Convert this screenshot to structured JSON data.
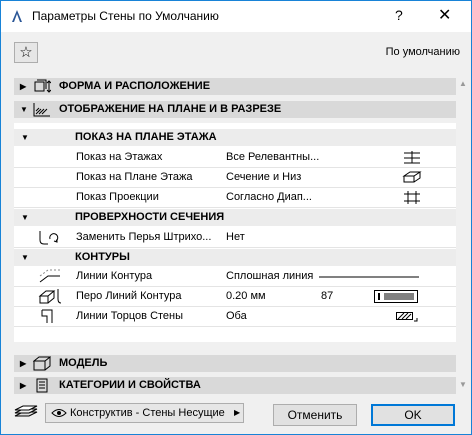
{
  "window": {
    "title": "Параметры Стены по Умолчанию",
    "help_label": "?",
    "close_label": "✕"
  },
  "toolbar": {
    "favorites_icon": "star-icon",
    "default_label": "По умолчанию"
  },
  "sections": [
    {
      "label": "ФОРМА И РАСПОЛОЖЕНИЕ",
      "icon": "wall-geometry-icon",
      "expanded": false
    },
    {
      "label": "ОТОБРАЖЕНИЕ НА ПЛАНЕ И В РАЗРЕЗЕ",
      "icon": "hatch-icon",
      "expanded": true
    },
    {
      "label": "МОДЕЛЬ",
      "icon": "box-icon",
      "expanded": false
    },
    {
      "label": "КАТЕГОРИИ И СВОЙСТВА",
      "icon": "document-icon",
      "expanded": false
    }
  ],
  "groups": [
    {
      "label": "ПОКАЗ НА ПЛАНЕ ЭТАЖА"
    },
    {
      "label": "ПРОВЕРХНОСТИ СЕЧЕНИЯ"
    },
    {
      "label": "КОНТУРЫ"
    }
  ],
  "rows": [
    {
      "name": "Показ на Этажах",
      "value": "Все Релевантны...",
      "icon": "stories-icon"
    },
    {
      "name": "Показ на Плане Этажа",
      "value": "Сечение и Низ",
      "icon": "floor-plan-icon"
    },
    {
      "name": "Показ Проекции",
      "value": "Согласно Диап...",
      "icon": "projection-icon"
    },
    {
      "name": "Заменить Перья Штрихо...",
      "value": "Нет",
      "icon": "pen-override-icon"
    },
    {
      "name": "Линии Контура",
      "value": "Сплошная линия",
      "icon": "contour-line-icon"
    },
    {
      "name": "Перо Линий Контура",
      "value": "0.20 мм",
      "number": "87",
      "icon": "pen-icon"
    },
    {
      "name": "Линии Торцов Стены",
      "value": "Оба",
      "icon": "wall-end-icon"
    }
  ],
  "footer": {
    "layer_value": "Конструктив - Стены Несущие",
    "cancel_label": "Отменить",
    "ok_label": "OK"
  },
  "colors": {
    "accent": "#0078d7",
    "section_bg": "#d9d9d9",
    "group_bg": "#ececec"
  }
}
